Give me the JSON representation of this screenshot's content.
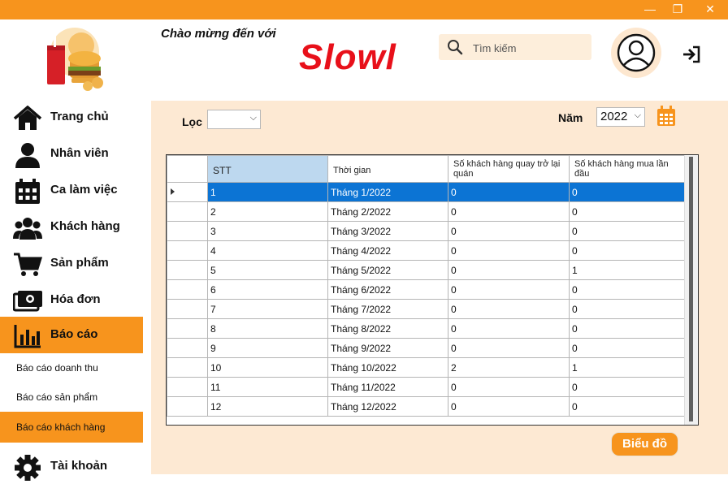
{
  "window": {
    "min_symbol": "—",
    "max_symbol": "❐",
    "close_symbol": "✕",
    "accent_color": "#f7941d"
  },
  "header": {
    "welcome": "Chào mừng đến với",
    "brand": "Slowl",
    "brand_color": "#e8101a",
    "search_placeholder": "Tìm kiếm",
    "icons": [
      "fast-food-logo-icon",
      "search-icon",
      "user-avatar-icon",
      "logout-icon"
    ]
  },
  "sidebar": {
    "items": [
      {
        "label": "Trang chủ",
        "icon": "home-icon"
      },
      {
        "label": "Nhân viên",
        "icon": "user-icon"
      },
      {
        "label": "Ca làm việc",
        "icon": "calendar-icon"
      },
      {
        "label": "Khách hàng",
        "icon": "customers-icon"
      },
      {
        "label": "Sản phẩm",
        "icon": "cart-icon"
      },
      {
        "label": "Hóa đơn",
        "icon": "cash-icon"
      },
      {
        "label": "Báo cáo",
        "icon": "bar-chart-icon",
        "active": true
      }
    ],
    "sub_items": [
      {
        "label": "Báo cáo doanh thu"
      },
      {
        "label": "Báo cáo sản phẩm"
      },
      {
        "label": "Báo cáo khách hàng",
        "active": true
      }
    ],
    "account": {
      "label": "Tài khoản",
      "icon": "gear-icon"
    }
  },
  "filters": {
    "filter_label": "Lọc",
    "filter_value": "",
    "year_label": "Năm",
    "year_value": "2022"
  },
  "table": {
    "columns": [
      "STT",
      "Thời gian",
      "Số khách hàng quay trở lại quán",
      "Số khách hàng mua lần đầu"
    ],
    "rows": [
      [
        "1",
        "Tháng 1/2022",
        "0",
        "0"
      ],
      [
        "2",
        "Tháng 2/2022",
        "0",
        "0"
      ],
      [
        "3",
        "Tháng 3/2022",
        "0",
        "0"
      ],
      [
        "4",
        "Tháng 4/2022",
        "0",
        "0"
      ],
      [
        "5",
        "Tháng 5/2022",
        "0",
        "1"
      ],
      [
        "6",
        "Tháng 6/2022",
        "0",
        "0"
      ],
      [
        "7",
        "Tháng 7/2022",
        "0",
        "0"
      ],
      [
        "8",
        "Tháng 8/2022",
        "0",
        "0"
      ],
      [
        "9",
        "Tháng 9/2022",
        "0",
        "0"
      ],
      [
        "10",
        "Tháng 10/2022",
        "2",
        "1"
      ],
      [
        "11",
        "Tháng 11/2022",
        "0",
        "0"
      ],
      [
        "12",
        "Tháng 12/2022",
        "0",
        "0"
      ]
    ],
    "selected_row": 0,
    "selection_color": "#0c74d4"
  },
  "actions": {
    "chart_button": "Biểu đồ"
  }
}
